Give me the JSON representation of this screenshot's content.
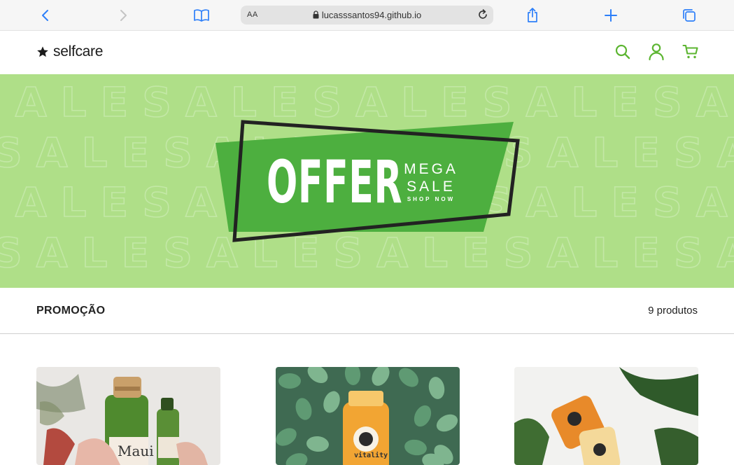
{
  "browser": {
    "text_size_label": "AA",
    "url": "lucasssantos94.github.io"
  },
  "header": {
    "logo_text": "selfcare",
    "accent_color": "#5cb531"
  },
  "banner": {
    "background_word": "SALE",
    "offer_word": "OFFER",
    "mega_word": "MEGA",
    "sale_word": "SALE",
    "shop_now": "SHOP NOW",
    "green": "#4daf3f",
    "light_green": "#afdf88"
  },
  "section": {
    "title": "PROMOÇÃO",
    "count": "9 produtos"
  },
  "products": [
    {
      "bottle_label": "Maui"
    },
    {
      "bottle_label": "vitality"
    },
    {
      "bottle_label": ""
    }
  ]
}
